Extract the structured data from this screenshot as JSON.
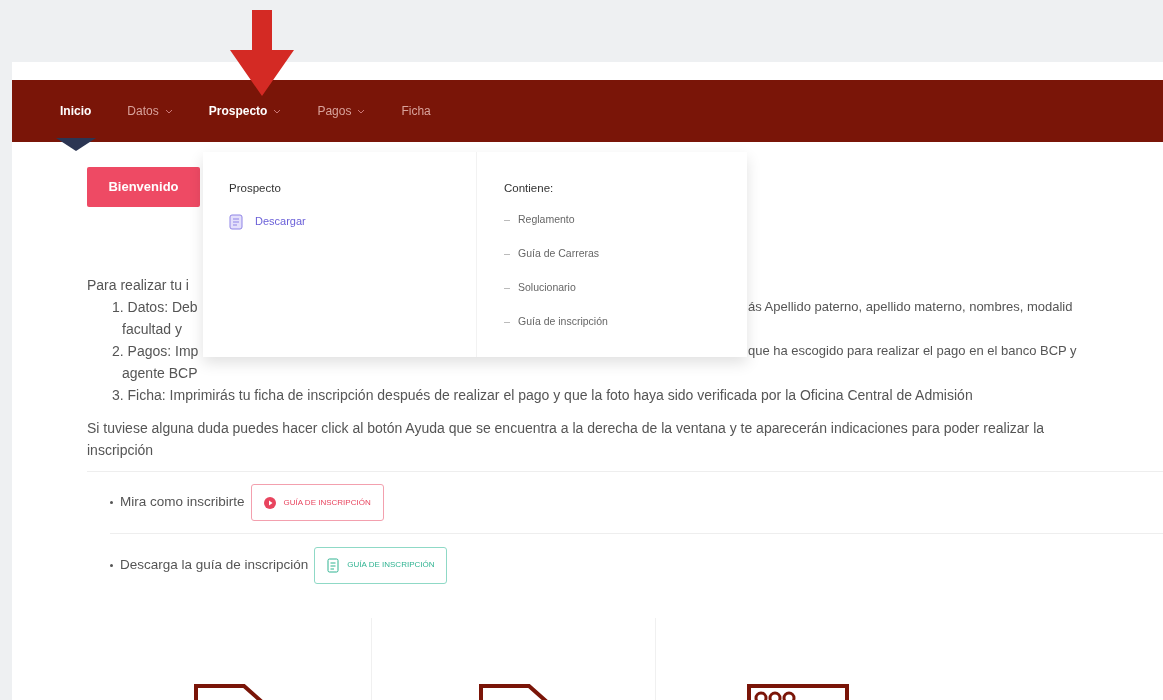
{
  "nav": {
    "items": [
      {
        "label": "Inicio",
        "has_dropdown": false,
        "current": true,
        "open": false
      },
      {
        "label": "Datos",
        "has_dropdown": true,
        "current": false,
        "open": false
      },
      {
        "label": "Prospecto",
        "has_dropdown": true,
        "current": false,
        "open": true
      },
      {
        "label": "Pagos",
        "has_dropdown": true,
        "current": false,
        "open": false
      },
      {
        "label": "Ficha",
        "has_dropdown": false,
        "current": false,
        "open": false
      }
    ]
  },
  "welcome_tab": {
    "label": "Bienvenido"
  },
  "dropdown": {
    "heading": "Prospecto",
    "links": [
      {
        "label": "Descargar"
      }
    ],
    "contents_heading": "Contiene:",
    "contents": [
      "Reglamento",
      "Guía de Carreras",
      "Solucionario",
      "Guía de inscripción"
    ]
  },
  "instructions": [
    {
      "kind": "intro",
      "left": "Para realizar tu i"
    },
    {
      "kind": "step",
      "left": "1. Datos: Deb",
      "right": "ás Apellido paterno, apellido materno, nombres, modalid"
    },
    {
      "kind": "continuation",
      "left": "facultad y"
    },
    {
      "kind": "step",
      "left": "2. Pagos: Imp",
      "right": "que ha escogido para realizar el pago en el banco BCP y"
    },
    {
      "kind": "continuation",
      "left": "agente BCP"
    },
    {
      "kind": "step",
      "left": "3. Ficha: Imprimirás tu ficha de inscripción después de realizar el pago y que la foto haya sido verificada por la Oficina Central de Admisión"
    }
  ],
  "help_text": "Si tuviese alguna duda puedes hacer click al botón Ayuda que se encuentra a la derecha de la ventana y te aparecerán indicaciones para poder realizar la inscripción",
  "resources": [
    {
      "kind": "video",
      "label": "Mira como inscribirte",
      "button": "GUÍA DE INSCRIPCIÓN"
    },
    {
      "kind": "download",
      "label": "Descarga la guía de inscripción",
      "button": "GUÍA DE INSCRIPCIÓN"
    }
  ],
  "feature_cards": [
    {
      "kind": "document"
    },
    {
      "kind": "document"
    },
    {
      "kind": "form"
    }
  ]
}
